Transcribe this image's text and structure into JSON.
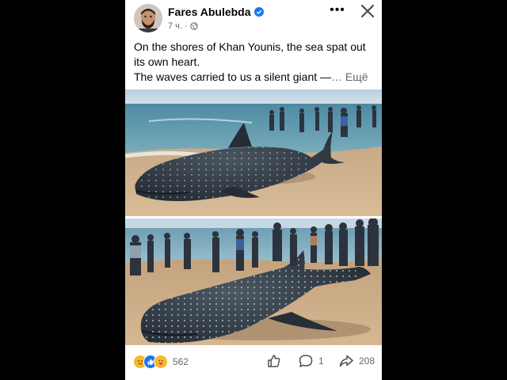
{
  "post": {
    "author": "Fares Abulebda",
    "time": "7 ч.",
    "caption_lines": [
      "On the shores of Khan Younis, the sea spat out its own heart.",
      "The waves carried to us a silent giant —"
    ],
    "see_more": "… Ещё",
    "reaction_count": "562",
    "comment_count": "1",
    "share_count": "208"
  },
  "icons": {
    "verified": "verified-badge-icon",
    "privacy": "globe-icon",
    "more": "more-options-icon",
    "close": "close-icon",
    "reactions": [
      "sad-reaction-icon",
      "like-reaction-icon",
      "care-reaction-icon"
    ],
    "like": "like-icon",
    "comment": "comment-icon",
    "share": "share-icon"
  },
  "colors": {
    "verified": "#1877f2",
    "text": "#050505",
    "secondary_text": "#65676b",
    "background": "#000000"
  }
}
